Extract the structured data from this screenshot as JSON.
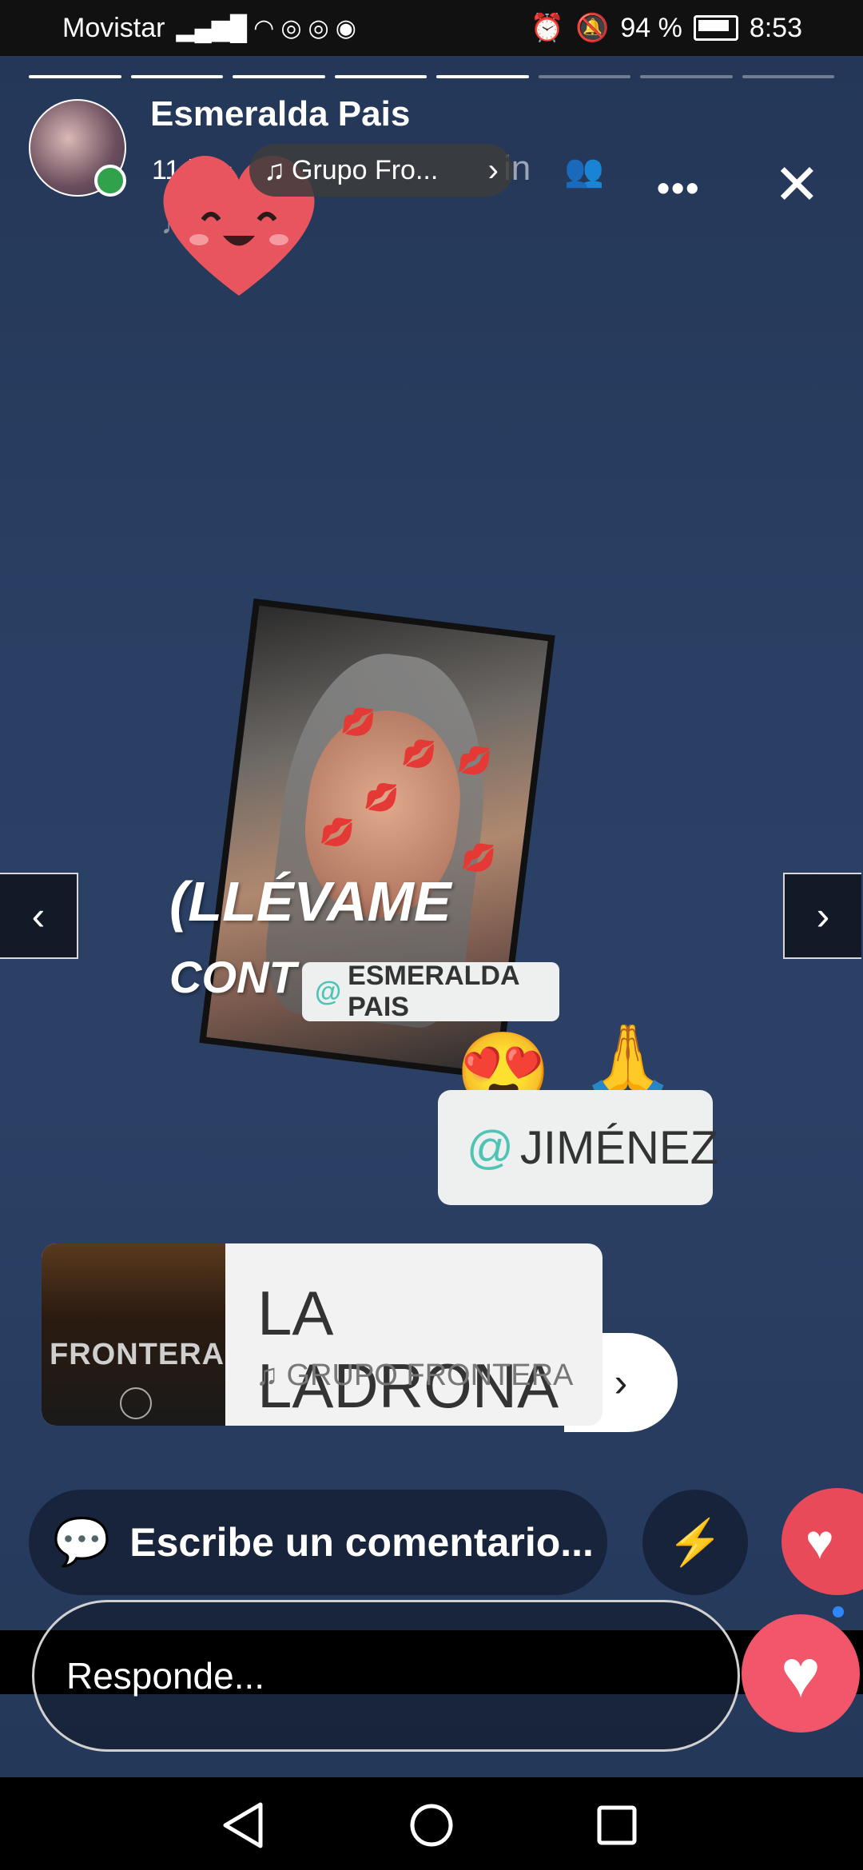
{
  "status_bar": {
    "carrier": "Movistar",
    "battery": "94 %",
    "time": "8:53"
  },
  "story": {
    "user_name": "Esmeralda Pais",
    "time_ago": "11 h",
    "music_label": "Grupo Fro...",
    "ghost_text": "in",
    "ghost_sub": "♫   ntos",
    "segments_done": 5,
    "segments_total": 8
  },
  "sticker_text": {
    "line1": "(LLÉVAME",
    "line2": "CONT",
    "mention1": "ESMERALDA PAIS",
    "mention2": "JIMÉNEZ"
  },
  "music_card": {
    "title": "LA LADRONA",
    "artist": "GRUPO FRONTERA",
    "album_text": "FRONTERA"
  },
  "comment": {
    "placeholder": "Escribe un comentario..."
  },
  "reply": {
    "placeholder": "Responde..."
  },
  "colors": {
    "like": "#e94a5a",
    "online": "#31a24c",
    "accent_mention": "#4fc4b5"
  }
}
